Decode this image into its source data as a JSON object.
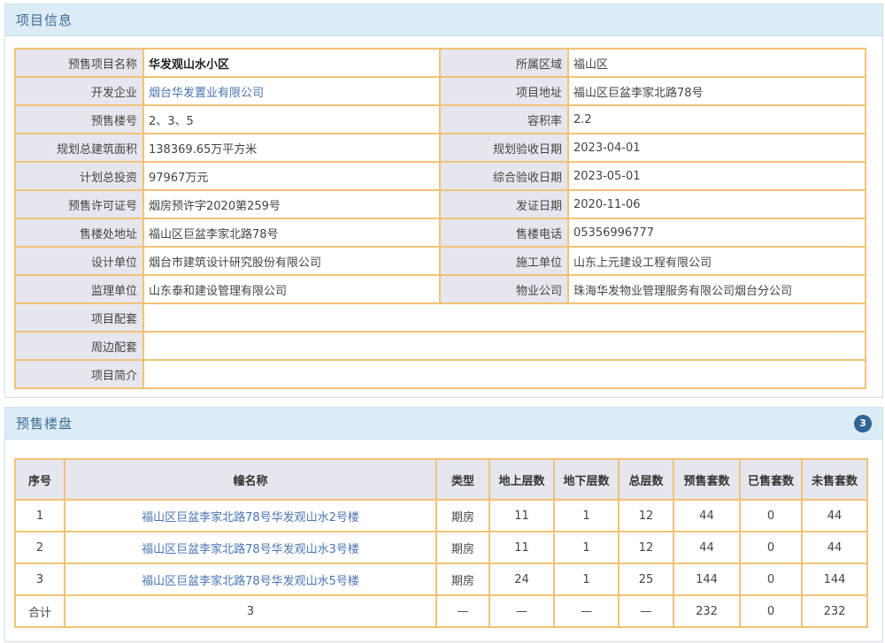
{
  "info_panel": {
    "title": "项目信息",
    "rows": [
      {
        "l1": "预售项目名称",
        "v1": "华发观山水小区",
        "l2": "所属区域",
        "v2": "福山区"
      },
      {
        "l1": "开发企业",
        "v1": "烟台华发置业有限公司",
        "l2": "项目地址",
        "v2": "福山区巨盆李家北路78号"
      },
      {
        "l1": "预售楼号",
        "v1": "2、3、5",
        "l2": "容积率",
        "v2": "2.2"
      },
      {
        "l1": "规划总建筑面积",
        "v1": "138369.65万平方米",
        "l2": "规划验收日期",
        "v2": "2023-04-01"
      },
      {
        "l1": "计划总投资",
        "v1": "97967万元",
        "l2": "综合验收日期",
        "v2": "2023-05-01"
      },
      {
        "l1": "预售许可证号",
        "v1": "烟房预许字2020第259号",
        "l2": "发证日期",
        "v2": "2020-11-06"
      },
      {
        "l1": "售楼处地址",
        "v1": "福山区巨盆李家北路78号",
        "l2": "售楼电话",
        "v2": "05356996777"
      },
      {
        "l1": "设计单位",
        "v1": "烟台市建筑设计研究股份有限公司",
        "l2": "施工单位",
        "v2": "山东上元建设工程有限公司"
      },
      {
        "l1": "监理单位",
        "v1": "山东泰和建设管理有限公司",
        "l2": "物业公司",
        "v2": "珠海华发物业管理服务有限公司烟台分公司"
      }
    ],
    "wide_rows": [
      {
        "label": "项目配套",
        "value": ""
      },
      {
        "label": "周边配套",
        "value": ""
      },
      {
        "label": "项目简介",
        "value": ""
      }
    ]
  },
  "presale_panel": {
    "title": "预售楼盘",
    "badge": "3",
    "headers": [
      "序号",
      "幢名称",
      "类型",
      "地上层数",
      "地下层数",
      "总层数",
      "预售套数",
      "已售套数",
      "未售套数"
    ],
    "rows": [
      [
        "1",
        "福山区巨盆李家北路78号华发观山水2号楼",
        "期房",
        "11",
        "1",
        "12",
        "44",
        "0",
        "44"
      ],
      [
        "2",
        "福山区巨盆李家北路78号华发观山水3号楼",
        "期房",
        "11",
        "1",
        "12",
        "44",
        "0",
        "44"
      ],
      [
        "3",
        "福山区巨盆李家北路78号华发观山水5号楼",
        "期房",
        "24",
        "1",
        "25",
        "144",
        "0",
        "144"
      ]
    ],
    "total": [
      "合计",
      "3",
      "—",
      "—",
      "—",
      "—",
      "232",
      "0",
      "232"
    ]
  }
}
